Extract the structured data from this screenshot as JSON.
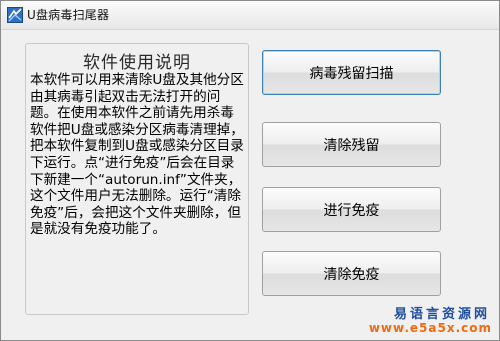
{
  "window": {
    "title": "U盘病毒扫尾器"
  },
  "instructions": {
    "heading": "软件使用说明",
    "body": "本软件可以用来清除U盘及其他分区由其病毒引起双击无法打开的问题。在使用本软件之前请先用杀毒软件把U盘或感染分区病毒清理掉，把本软件复制到U盘或感染分区目录下运行。点“进行免疫”后会在目录下新建一个“autorun.inf”文件夹，这个文件用户无法删除。运行“清除免疫”后，会把这个文件夹删除，但是就没有免疫功能了。"
  },
  "buttons": {
    "scan": "病毒残留扫描",
    "clear": "清除残留",
    "immunize": "进行免疫",
    "remove_immunity": "清除免疫"
  },
  "watermark": {
    "site_name": "易语言资源网",
    "url": "www.e5a5x.com"
  },
  "icons": {
    "app": "app-icon"
  }
}
